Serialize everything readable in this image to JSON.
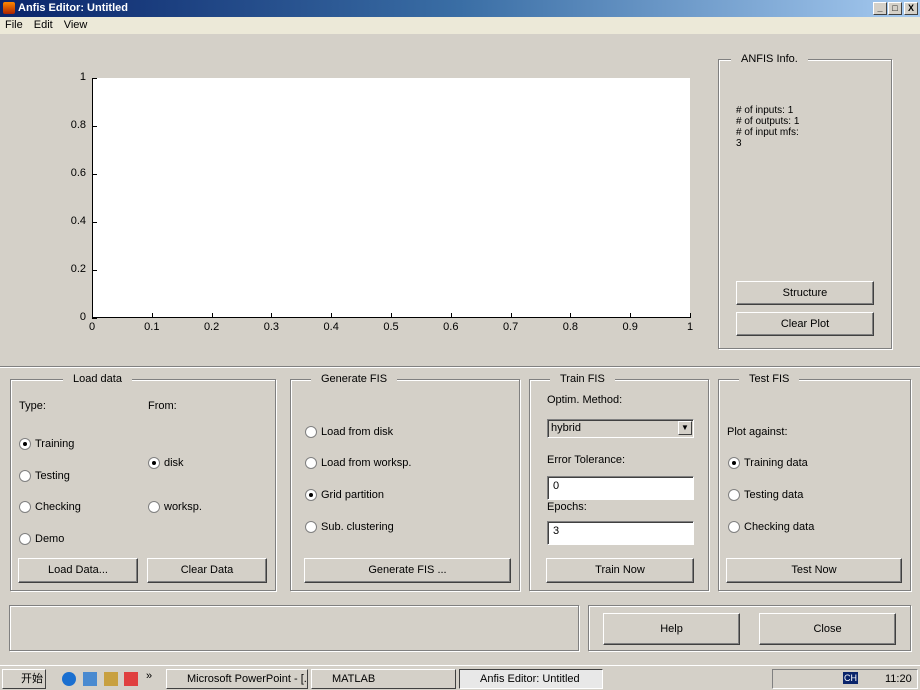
{
  "window": {
    "title": "Anfis Editor: Untitled",
    "minimize": "_",
    "maximize": "□",
    "close": "X"
  },
  "menu": [
    "File",
    "Edit",
    "View"
  ],
  "chart_data": {
    "type": "line",
    "title": "",
    "xlabel": "",
    "ylabel": "",
    "xlim": [
      0,
      1
    ],
    "ylim": [
      0,
      1
    ],
    "xticks": [
      "0",
      "0.1",
      "0.2",
      "0.3",
      "0.4",
      "0.5",
      "0.6",
      "0.7",
      "0.8",
      "0.9",
      "1"
    ],
    "yticks": [
      "0",
      "0.2",
      "0.4",
      "0.6",
      "0.8",
      "1"
    ],
    "series": []
  },
  "info": {
    "title": "ANFIS Info.",
    "lines": [
      "# of inputs: 1",
      "# of outputs: 1",
      "# of input mfs:",
      "3"
    ],
    "structure": "Structure",
    "clear_plot": "Clear Plot"
  },
  "load": {
    "title": "Load data",
    "type_label": "Type:",
    "from_label": "From:",
    "types": [
      {
        "label": "Training",
        "checked": true
      },
      {
        "label": "Testing",
        "checked": false
      },
      {
        "label": "Checking",
        "checked": false
      },
      {
        "label": "Demo",
        "checked": false
      }
    ],
    "from": [
      {
        "label": "disk",
        "checked": true
      },
      {
        "label": "worksp.",
        "checked": false
      }
    ],
    "load_btn": "Load Data...",
    "clear_btn": "Clear Data"
  },
  "generate": {
    "title": "Generate FIS",
    "options": [
      {
        "label": "Load from disk",
        "checked": false
      },
      {
        "label": "Load from worksp.",
        "checked": false
      },
      {
        "label": "Grid partition",
        "checked": true
      },
      {
        "label": "Sub. clustering",
        "checked": false
      }
    ],
    "button": "Generate FIS ..."
  },
  "train": {
    "title": "Train FIS",
    "method_label": "Optim. Method:",
    "method": "hybrid",
    "tol_label": "Error Tolerance:",
    "tol": "0",
    "epochs_label": "Epochs:",
    "epochs": "3",
    "button": "Train Now"
  },
  "test": {
    "title": "Test FIS",
    "plot_label": "Plot against:",
    "options": [
      {
        "label": "Training data",
        "checked": true
      },
      {
        "label": "Testing data",
        "checked": false
      },
      {
        "label": "Checking data",
        "checked": false
      }
    ],
    "button": "Test Now"
  },
  "status": "",
  "help": "Help",
  "close": "Close",
  "taskbar": {
    "start": "开始",
    "items": [
      "Microsoft PowerPoint - [...",
      "MATLAB",
      "Anfis Editor: Untitled"
    ],
    "lang": "CH",
    "clock": "11:20"
  }
}
